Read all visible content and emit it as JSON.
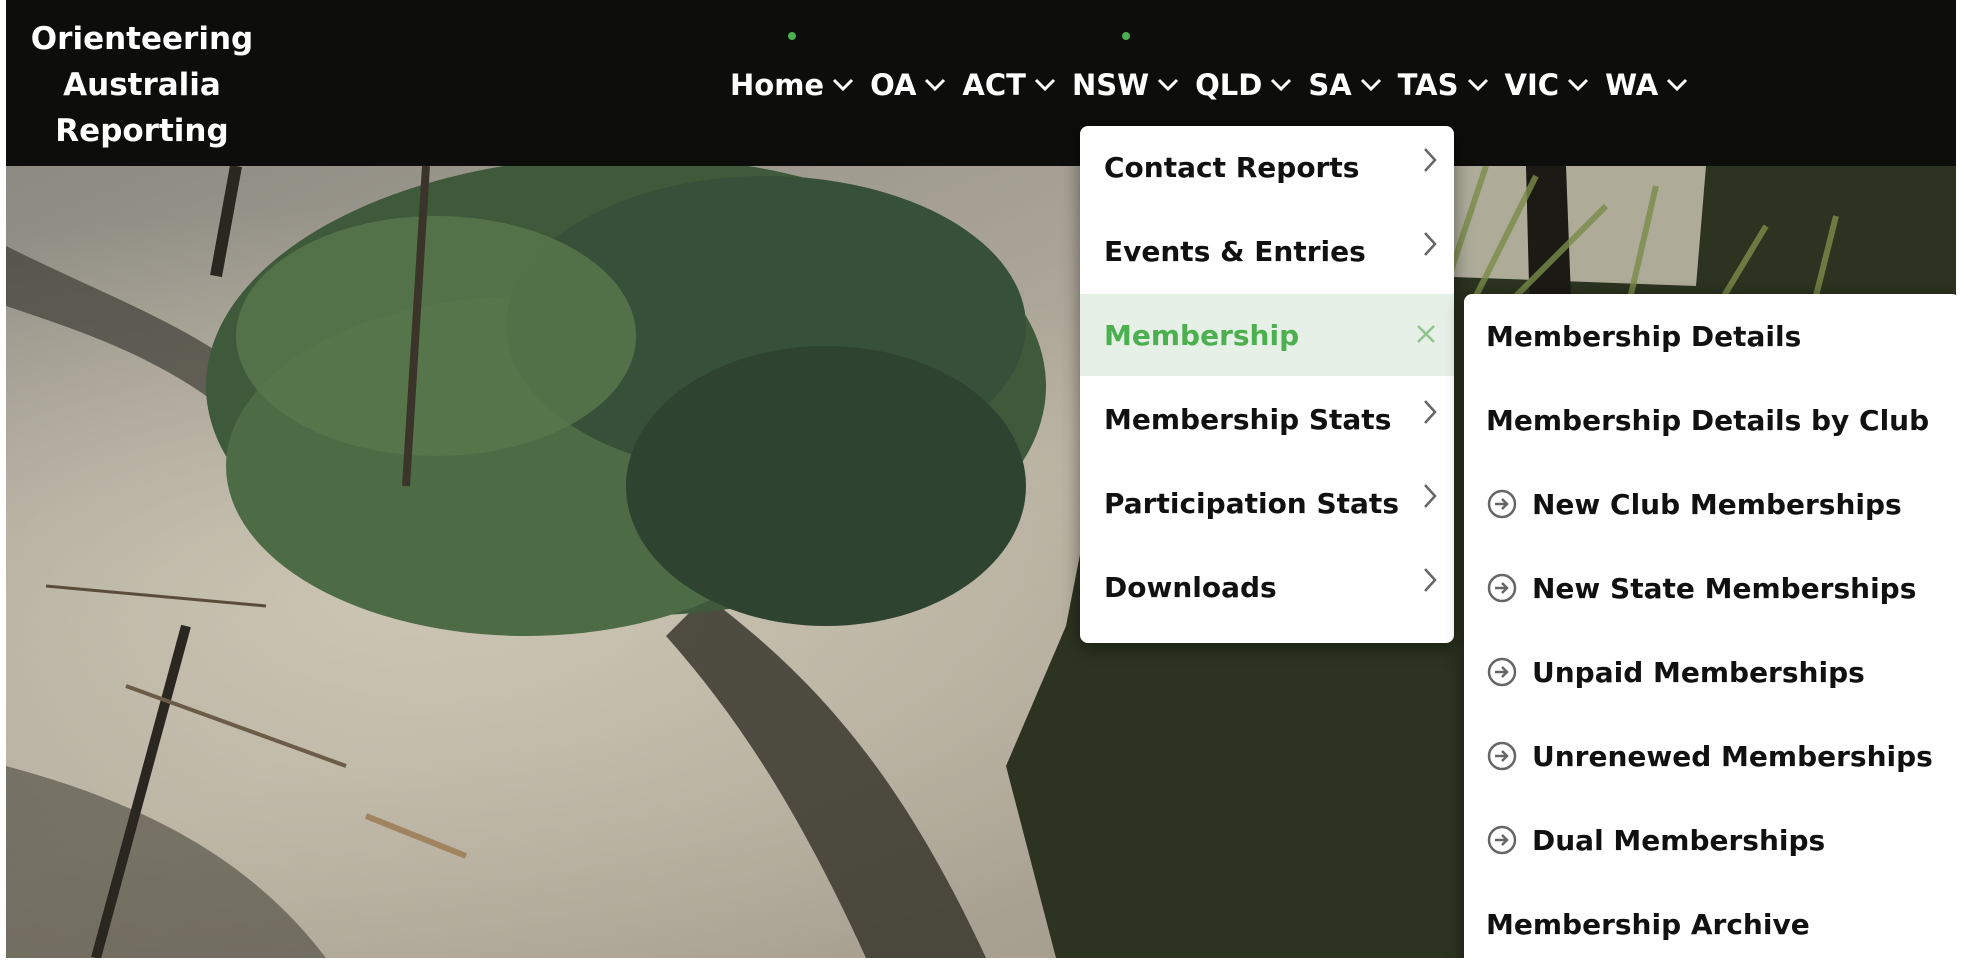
{
  "brand": {
    "line1": "Orienteering",
    "line2": "Australia",
    "line3": "Reporting"
  },
  "nav": {
    "items": [
      {
        "label": "Home"
      },
      {
        "label": "OA"
      },
      {
        "label": "ACT"
      },
      {
        "label": "NSW"
      },
      {
        "label": "QLD"
      },
      {
        "label": "SA"
      },
      {
        "label": "TAS"
      },
      {
        "label": "VIC"
      },
      {
        "label": "WA"
      }
    ]
  },
  "nsw_menu": {
    "items": [
      {
        "label": "Contact Reports"
      },
      {
        "label": "Events & Entries"
      },
      {
        "label": "Membership"
      },
      {
        "label": "Membership Stats"
      },
      {
        "label": "Participation Stats"
      },
      {
        "label": "Downloads"
      }
    ]
  },
  "membership_menu": {
    "items": [
      {
        "label": "Membership Details"
      },
      {
        "label": "Membership Details by Club"
      },
      {
        "label": "New Club Memberships"
      },
      {
        "label": "New State Memberships"
      },
      {
        "label": "Unpaid Memberships"
      },
      {
        "label": "Unrenewed Memberships"
      },
      {
        "label": "Dual Memberships"
      },
      {
        "label": "Membership Archive"
      }
    ]
  },
  "colors": {
    "navbar": "#0d0d0b",
    "accent": "#4caf50",
    "active_bg": "#e6f0e6",
    "text": "#111111"
  },
  "icons": {
    "nav_chevron": "chevron-down-icon",
    "menu_arrow": "chevron-right-icon",
    "close": "close-icon",
    "link": "circle-arrow-right-icon"
  }
}
